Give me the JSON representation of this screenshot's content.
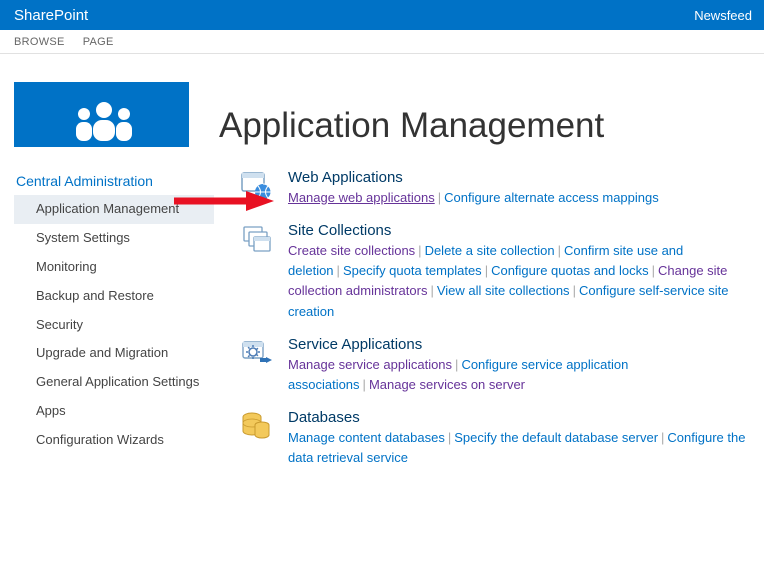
{
  "topbar": {
    "brand": "SharePoint",
    "newsfeed": "Newsfeed"
  },
  "ribbon": {
    "browse": "BROWSE",
    "page": "PAGE"
  },
  "hero": {
    "title": "Application Management"
  },
  "sidebar": {
    "title": "Central Administration",
    "items": [
      "Application Management",
      "System Settings",
      "Monitoring",
      "Backup and Restore",
      "Security",
      "Upgrade and Migration",
      "General Application Settings",
      "Apps",
      "Configuration Wizards"
    ]
  },
  "sections": {
    "webapps": {
      "title": "Web Applications",
      "links": [
        "Manage web applications",
        "Configure alternate access mappings"
      ]
    },
    "sitecoll": {
      "title": "Site Collections",
      "links": [
        "Create site collections",
        "Delete a site collection",
        "Confirm site use and deletion",
        "Specify quota templates",
        "Configure quotas and locks",
        "Change site collection administrators",
        "View all site collections",
        "Configure self-service site creation"
      ]
    },
    "svcapps": {
      "title": "Service Applications",
      "links": [
        "Manage service applications",
        "Configure service application associations",
        "Manage services on server"
      ]
    },
    "db": {
      "title": "Databases",
      "links": [
        "Manage content databases",
        "Specify the default database server",
        "Configure the data retrieval service"
      ]
    }
  }
}
